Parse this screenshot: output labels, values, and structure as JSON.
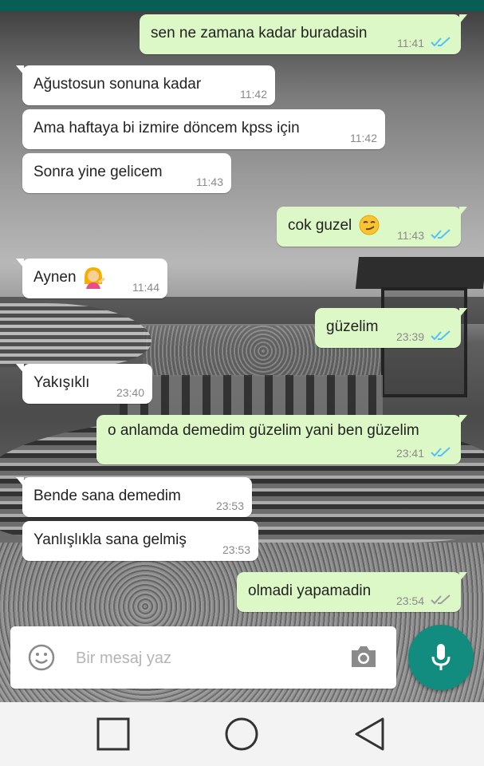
{
  "colors": {
    "header": "#075e54",
    "incoming_bubble": "#ffffff",
    "outgoing_bubble": "#dcf8c6",
    "read_tick": "#4fc3f7",
    "sent_tick": "#9e9e9e",
    "mic_button": "#128c7e"
  },
  "messages": [
    {
      "dir": "out",
      "text": "sen ne zamana kadar buradasin",
      "time": "11:41",
      "status": "read"
    },
    {
      "dir": "in",
      "text": "Ağustosun sonuna kadar",
      "time": "11:42"
    },
    {
      "dir": "in",
      "text": "Ama haftaya bi izmire döncem kpss için",
      "time": "11:42"
    },
    {
      "dir": "in",
      "text": "Sonra yine gelicem",
      "time": "11:43"
    },
    {
      "dir": "out",
      "text": "cok guzel",
      "emoji": "smirking-face",
      "time": "11:43",
      "status": "read"
    },
    {
      "dir": "in",
      "text": "Aynen",
      "emoji": "woman-tipping-hand",
      "time": "11:44"
    },
    {
      "dir": "out",
      "text": "güzelim",
      "time": "23:39",
      "status": "read"
    },
    {
      "dir": "in",
      "text": "Yakışıklı",
      "time": "23:40"
    },
    {
      "dir": "out",
      "text": "o anlamda demedim güzelim yani ben güzelim",
      "time": "23:41",
      "status": "read"
    },
    {
      "dir": "in",
      "text": "Bende sana demedim",
      "time": "23:53"
    },
    {
      "dir": "in",
      "text": "Yanlışlıkla sana gelmiş",
      "time": "23:53"
    },
    {
      "dir": "out",
      "text": "olmadi yapamadin",
      "time": "23:54",
      "status": "delivered"
    }
  ],
  "composer": {
    "placeholder": "Bir mesaj yaz",
    "emoji_icon": "emoji-icon",
    "camera_icon": "camera-icon",
    "mic_icon": "mic-icon"
  },
  "navbar": {
    "recents_icon": "square-recents-icon",
    "home_icon": "circle-home-icon",
    "back_icon": "triangle-back-icon"
  }
}
